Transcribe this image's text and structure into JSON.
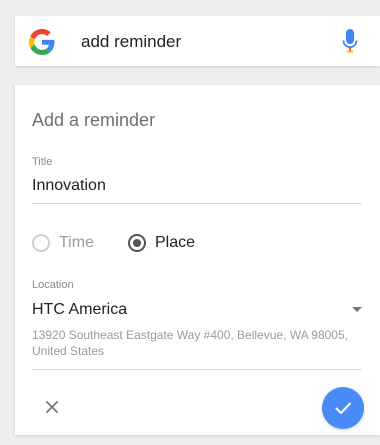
{
  "search": {
    "query": "add reminder",
    "logo_icon": "google-g-logo",
    "mic_icon": "microphone-icon"
  },
  "reminder_card": {
    "heading": "Add a reminder",
    "title_field": {
      "label": "Title",
      "value": "Innovation"
    },
    "trigger_options": [
      {
        "label": "Time",
        "selected": false
      },
      {
        "label": "Place",
        "selected": true
      }
    ],
    "location_field": {
      "label": "Location",
      "value": "HTC America",
      "address": "13920 Southeast Eastgate Way #400, Bellevue, WA 98005, United States"
    },
    "actions": {
      "cancel_icon": "close-icon",
      "confirm_icon": "check-icon"
    }
  },
  "colors": {
    "accent": "#4a8af4",
    "background": "#ededed",
    "card": "#ffffff"
  }
}
